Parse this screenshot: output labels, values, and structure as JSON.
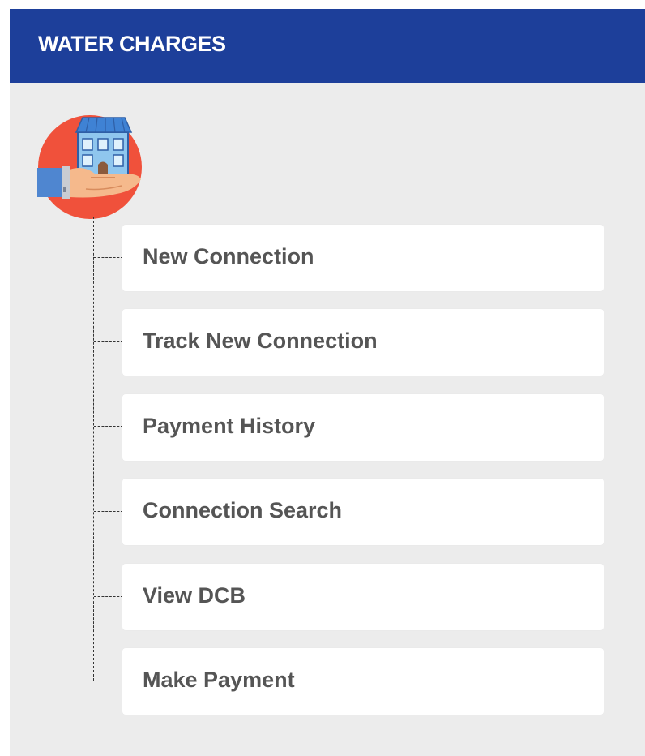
{
  "header": {
    "title": "WATER CHARGES"
  },
  "logo": {
    "icon": "hand-holding-building-icon",
    "colors": {
      "circle": "#f0513b",
      "roof": "#3f82d4",
      "building": "#8fc6ee",
      "hand": "#f5b98c",
      "sleeve": "#4f86d0"
    }
  },
  "menu": {
    "items": [
      {
        "label": "New Connection"
      },
      {
        "label": "Track New Connection"
      },
      {
        "label": "Payment History"
      },
      {
        "label": "Connection Search"
      },
      {
        "label": "View DCB"
      },
      {
        "label": "Make Payment"
      }
    ]
  },
  "colors": {
    "header_bg": "#1d3f9a",
    "card_bg": "#ececec",
    "item_bg": "#ffffff",
    "item_text": "#555555"
  }
}
